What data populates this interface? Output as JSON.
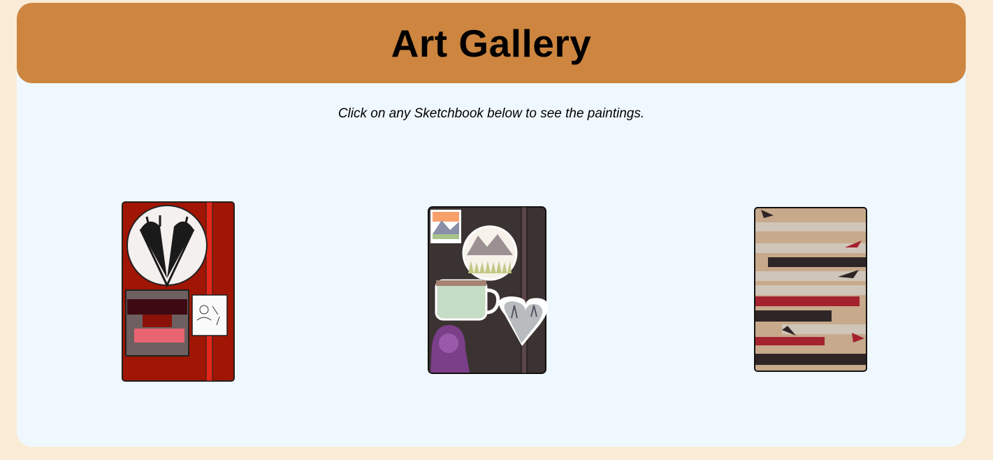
{
  "header": {
    "title": "Art Gallery"
  },
  "intro": {
    "text": "Click on any Sketchbook below to see the paintings."
  },
  "sketchbooks": [
    {
      "name": "red-sketchbook",
      "icon": "red-sketchbook-icon",
      "color": "#a11a04"
    },
    {
      "name": "black-sketchbook",
      "icon": "black-sketchbook-icon",
      "color": "#3a3230"
    },
    {
      "name": "fish-sketchbook",
      "icon": "fish-pattern-sketchbook-icon",
      "color": "#c4a88a"
    }
  ],
  "colors": {
    "page_bg": "#faebd7",
    "card_bg": "#f0f8ff",
    "header_bg": "#cd853f"
  }
}
